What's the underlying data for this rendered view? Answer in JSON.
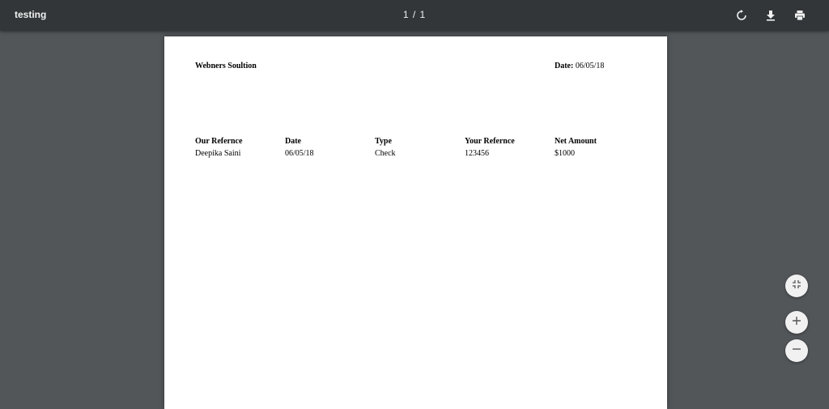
{
  "toolbar": {
    "title": "testing",
    "page_counter": "1 / 1",
    "icons": [
      "rotate-icon",
      "download-icon",
      "print-icon"
    ]
  },
  "document": {
    "company": "Webners Soultion",
    "date_label": "Date:",
    "date_value": "06/05/18",
    "table": {
      "headers": [
        "Our Refernce",
        "Date",
        "Type",
        "Your Refernce",
        "Net Amount"
      ],
      "rows": [
        [
          "Deepika Saini",
          "06/05/18",
          "Check",
          "123456",
          "$1000"
        ]
      ]
    }
  },
  "zoom_controls": {
    "icons": [
      "fit-page-icon",
      "zoom-in-icon",
      "zoom-out-icon"
    ]
  },
  "colors": {
    "toolbar_bg": "#323639",
    "viewer_bg": "#525659",
    "page_bg": "#ffffff",
    "fab_bg": "#f1f1f1"
  }
}
